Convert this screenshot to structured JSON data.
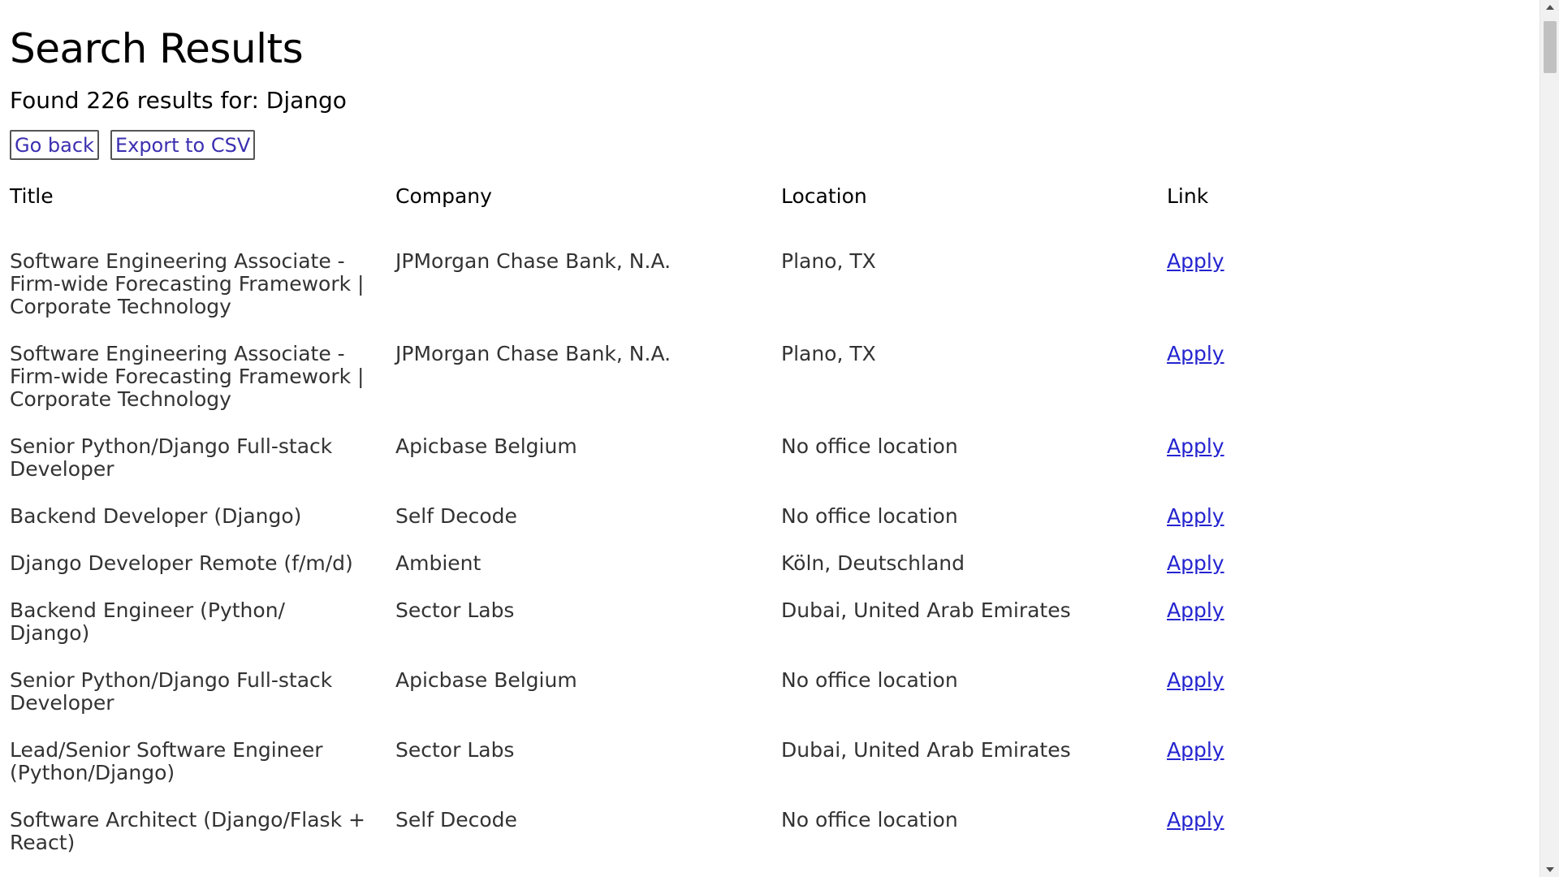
{
  "page": {
    "title": "Search Results",
    "summary": "Found 226 results for: Django"
  },
  "actions": {
    "go_back": "Go back",
    "export": "Export to CSV"
  },
  "table": {
    "headers": [
      "Title",
      "Company",
      "Location",
      "Link"
    ],
    "rows": [
      {
        "title": "Software Engineering Associate - Firm-wide Forecasting Framework | Corporate Technology",
        "company": "JPMorgan Chase Bank, N.A.",
        "location": "Plano, TX",
        "link": "Apply"
      },
      {
        "title": "Software Engineering Associate - Firm-wide Forecasting Framework | Corporate Technology",
        "company": "JPMorgan Chase Bank, N.A.",
        "location": "Plano, TX",
        "link": "Apply"
      },
      {
        "title": "Senior Python/Django Full-stack Developer",
        "company": "Apicbase Belgium",
        "location": "No office location",
        "link": "Apply"
      },
      {
        "title": "Backend Developer (Django)",
        "company": "Self Decode",
        "location": "No office location",
        "link": "Apply"
      },
      {
        "title": "Django Developer Remote (f/m/d)",
        "company": "Ambient",
        "location": "Köln, Deutschland",
        "link": "Apply"
      },
      {
        "title": "Backend Engineer (Python/ Django)",
        "company": "Sector Labs",
        "location": "Dubai, United Arab Emirates",
        "link": "Apply"
      },
      {
        "title": "Senior Python/Django Full-stack Developer",
        "company": "Apicbase Belgium",
        "location": "No office location",
        "link": "Apply"
      },
      {
        "title": "Lead/Senior Software Engineer (Python/Django)",
        "company": "Sector Labs",
        "location": "Dubai, United Arab Emirates",
        "link": "Apply"
      },
      {
        "title": "Software Architect (Django/Flask + React)",
        "company": "Self Decode",
        "location": "No office location",
        "link": "Apply"
      }
    ]
  },
  "colors": {
    "link": "#2424d0",
    "button_text": "#3b2fb0",
    "scrollbar_thumb": "#c1c1c1"
  }
}
